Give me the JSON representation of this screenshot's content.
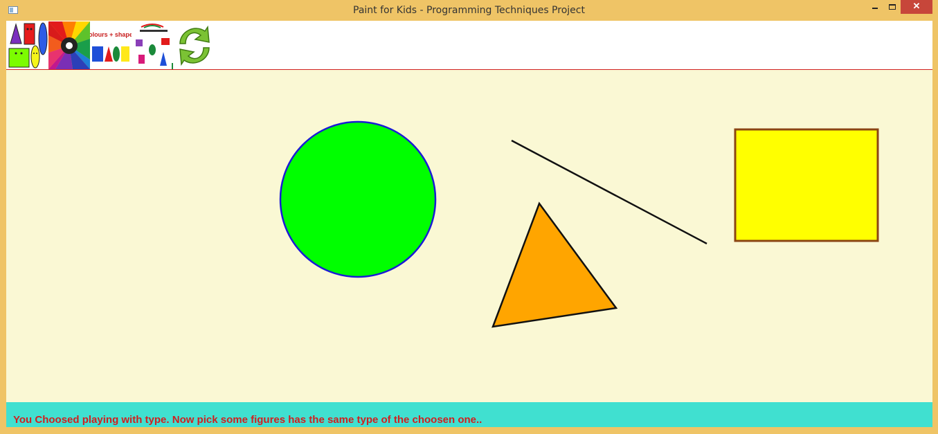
{
  "window": {
    "title": "Paint for Kids - Programming Techniques Project",
    "close_glyph": "✕"
  },
  "toolbar": {
    "items": [
      {
        "name": "Draw figures",
        "icon": "shapes-icon"
      },
      {
        "name": "Colors",
        "icon": "color-wheel-icon"
      },
      {
        "name": "Play with colours and shapes",
        "icon": "colours-shapes-icon",
        "logo_text": "colours + shapes"
      },
      {
        "name": "Play with figure types",
        "icon": "figure-types-icon"
      },
      {
        "name": "Switch mode",
        "icon": "refresh-icon"
      }
    ]
  },
  "figures": [
    {
      "type": "circle",
      "fill": "#00ff00",
      "border": "#1a1ad6"
    },
    {
      "type": "line",
      "color": "#111111"
    },
    {
      "type": "triangle",
      "fill": "#ffa500",
      "border": "#111111"
    },
    {
      "type": "rectangle",
      "fill": "#ffff00",
      "border": "#8b4513"
    }
  ],
  "colors": {
    "canvas": "#faf8d4",
    "status_bar": "#40e0d0",
    "status_text": "#d11f1f",
    "frame": "#efc466"
  },
  "status": {
    "message": "You Choosed playing with type. Now pick some figures has the same type of the choosen one.."
  }
}
